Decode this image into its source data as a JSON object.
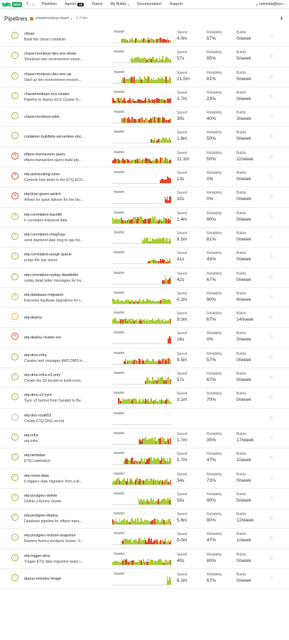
{
  "topbar": {
    "new_badge": "NEW",
    "org_short": "T...",
    "nav": [
      "Pipelines",
      "Agents",
      "Teams",
      "My Builds",
      "Documentation",
      "Support"
    ],
    "agents_count": "19",
    "user": "ralmeida@tyro..."
  },
  "header": {
    "title": "Pipelines",
    "org": "chaosmonkeys-team",
    "filter_placeholder": "Filter",
    "plus": "+"
  },
  "labels": {
    "speed": "Speed",
    "reliability": "Reliability",
    "builds": "Builds",
    "star": "☆"
  },
  "colors": {
    "pass": "#a9cc35",
    "fail": "#e0452f",
    "running": "#f2b32a"
  },
  "pipelines": [
    {
      "name": "cfman",
      "desc": "Build the cfman container",
      "status": "passed",
      "branch": "master",
      "speed": "4.0m",
      "reliability": "57%",
      "builds": "0/week",
      "chart": {
        "fill": 0.85,
        "height": 0.55,
        "fail": 0.35
      }
    },
    {
      "name": "chaos-monkeys-dev-env-down",
      "desc": "Shutdown dev environment resour...",
      "status": "passed",
      "branch": "master",
      "speed": "57s",
      "reliability": "95%",
      "builds": "5/week",
      "chart": {
        "fill": 0.7,
        "height": 0.7,
        "fail": 0.05
      }
    },
    {
      "name": "chaos-monkeys-dev-env-up",
      "desc": "Start up dev environment resourc...",
      "status": "passed",
      "branch": "master",
      "speed": "21.5m",
      "reliability": "81%",
      "builds": "5/week",
      "chart": {
        "fill": 0.85,
        "height": 0.75,
        "fail": 0.15
      }
    },
    {
      "name": "chaosmonkeys-ecs-cluster",
      "desc": "Pipeline to deploy ECS Cluster fo...",
      "status": "passed",
      "branch": "master",
      "speed": "3.7m",
      "reliability": "23%",
      "builds": "0/week",
      "chart": {
        "fill": 1.0,
        "height": 0.55,
        "fail": 0.7
      }
    },
    {
      "name": "chaos-monkeys-jobs",
      "desc": "",
      "status": "passed",
      "branch": "master",
      "speed": "30s",
      "reliability": "40%",
      "builds": "3/week",
      "chart": {
        "fill": 0.85,
        "height": 0.7,
        "fail": 0.45
      }
    },
    {
      "name": "container-buildkite-serverless-doc...",
      "desc": "",
      "status": "passed",
      "branch": "master",
      "speed": "1.6m",
      "reliability": "50%",
      "builds": "0/week",
      "chart": {
        "fill": 0.35,
        "height": 0.6,
        "fail": 0.4
      }
    },
    {
      "name": "eftpos-transaction-query",
      "desc": "eftpos-transaction-query build pip...",
      "status": "failed",
      "branch": "master",
      "speed": "11.1m",
      "reliability": "50%",
      "builds": "11/week",
      "chart": {
        "fill": 1.0,
        "height": 0.6,
        "fail": 0.45
      }
    },
    {
      "name": "etq-autoscaling-rules",
      "desc": "Controls how tasks in the ETQ ECS...",
      "status": "failed",
      "branch": "master",
      "speed": "13s",
      "reliability": "0%",
      "builds": "0/week",
      "chart": {
        "fill": 0.2,
        "height": 0.8,
        "fail": 1.0
      }
    },
    {
      "name": "etq-blue-green-switch",
      "desc": "Allows for quick failover for the blu...",
      "status": "failed",
      "branch": "master",
      "speed": "32s",
      "reliability": "0%",
      "builds": "0/week",
      "chart": {
        "fill": 0.12,
        "height": 0.8,
        "fail": 1.0
      }
    },
    {
      "name": "etq-correlation-backfill",
      "desc": "It correlates historical data",
      "status": "paused",
      "branch": "master",
      "speed": "2.4m",
      "reliability": "90%",
      "builds": "0/week",
      "chart": {
        "fill": 1.0,
        "height": 0.75,
        "fail": 0.3
      }
    },
    {
      "name": "etq-correlation-msg2sqs",
      "desc": "send start/end date msg to sqs for...",
      "status": "passed",
      "branch": "master",
      "speed": "8.5m",
      "reliability": "81%",
      "builds": "0/week",
      "chart": {
        "fill": 0.5,
        "height": 0.65,
        "fail": 0.2
      }
    },
    {
      "name": "etq-correlation-purge-queue",
      "desc": "purge the sqs queue",
      "status": "passed",
      "branch": "master",
      "speed": "41s",
      "reliability": "43%",
      "builds": "0/week",
      "chart": {
        "fill": 0.4,
        "height": 0.55,
        "fail": 0.45
      }
    },
    {
      "name": "etq-correlation-replay-deadletter",
      "desc": "replay dead letter messages for tra...",
      "status": "passed",
      "branch": "master",
      "speed": "42s",
      "reliability": "67%",
      "builds": "0/week",
      "chart": {
        "fill": 0.15,
        "height": 0.9,
        "fail": 0.4
      }
    },
    {
      "name": "etq-database-migration",
      "desc": "Executes liquibase migrations for t...",
      "status": "paused",
      "branch": "master",
      "speed": "6.2m",
      "reliability": "90%",
      "builds": "6/week",
      "chart": {
        "fill": 1.0,
        "height": 0.55,
        "fail": 0.15
      }
    },
    {
      "name": "etq-deploy",
      "desc": "",
      "status": "running",
      "branch": "master",
      "speed": "9.0m",
      "reliability": "67%",
      "builds": "14/week",
      "chart": {
        "fill": 1.0,
        "height": 0.6,
        "fail": 0.2
      }
    },
    {
      "name": "etq-deploy-cluster-svc",
      "desc": "",
      "status": "failed",
      "branch": "master",
      "speed": "16s",
      "reliability": "0%",
      "builds": "0/week",
      "chart": {
        "fill": 0.06,
        "height": 0.9,
        "fail": 1.0
      }
    },
    {
      "name": "etq-dms-infra",
      "desc": "Creates and manages AWS DMS in...",
      "status": "passed",
      "branch": "master",
      "speed": "9.5m",
      "reliability": "57%",
      "builds": "0/week",
      "chart": {
        "fill": 0.8,
        "height": 0.6,
        "fail": 0.45
      }
    },
    {
      "name": "etq-dms-infra-s3-only",
      "desc": "Create the S3 bucket in build envir...",
      "status": "passed",
      "branch": "master",
      "speed": "57s",
      "reliability": "67%",
      "builds": "0/week",
      "chart": {
        "fill": 0.45,
        "height": 0.8,
        "fail": 0.3
      }
    },
    {
      "name": "etq-dms-s3-sync",
      "desc": "Sync s3 bucket from Sandpit to Bu...",
      "status": "passed",
      "branch": "master",
      "speed": "3.1m",
      "reliability": "70%",
      "builds": "0/week",
      "chart": {
        "fill": 0.9,
        "height": 0.7,
        "fail": 0.2
      }
    },
    {
      "name": "etq-dns-route53",
      "desc": "Create ETQ DNS record",
      "status": "none",
      "branch": "master",
      "speed": "",
      "reliability": "",
      "builds": "",
      "chart": {
        "fill": 0.0,
        "height": 0.0,
        "fail": 0.0
      }
    },
    {
      "name": "etq-infra",
      "desc": "etq-infra",
      "status": "passed",
      "branch": "master",
      "speed": "1.7m",
      "reliability": "35%",
      "builds": "17/week",
      "chart": {
        "fill": 0.55,
        "height": 0.75,
        "fail": 0.5
      }
    },
    {
      "name": "etq-lambdas",
      "desc": "ETQ Lambda(s)",
      "status": "passed",
      "branch": "master",
      "speed": "5.7m",
      "reliability": "47%",
      "builds": "1/week",
      "chart": {
        "fill": 0.8,
        "height": 0.8,
        "fail": 0.35
      }
    },
    {
      "name": "etq-move-data",
      "desc": "It triggers data migration from a bl...",
      "status": "passed",
      "branch": "master",
      "speed": "34s",
      "reliability": "73%",
      "builds": "0/week",
      "chart": {
        "fill": 1.0,
        "height": 0.7,
        "fail": 0.25
      }
    },
    {
      "name": "etq-postgres-delete",
      "desc": "Delete a Aurora cluster",
      "status": "passed",
      "branch": "master",
      "speed": "50s",
      "reliability": "90%",
      "builds": "5/week",
      "chart": {
        "fill": 0.55,
        "height": 0.75,
        "fail": 0.15
      }
    },
    {
      "name": "etq-postgres-deploy",
      "desc": "Database pipeline for eftpos-trans...",
      "status": "passed",
      "branch": "master",
      "speed": "5.6m",
      "reliability": "90%",
      "builds": "12/week",
      "chart": {
        "fill": 1.0,
        "height": 0.7,
        "fail": 0.15
      }
    },
    {
      "name": "etq-postgres-restore-snapshot",
      "desc": "Restore Aurora postgres cluster. V...",
      "status": "passed",
      "branch": "master",
      "speed": "9.0m",
      "reliability": "47%",
      "builds": "1/week",
      "chart": {
        "fill": 0.85,
        "height": 0.75,
        "fail": 0.4
      }
    },
    {
      "name": "etq-trigger-dms",
      "desc": "Trigger ETQ data migration tasks i...",
      "status": "passed",
      "branch": "master",
      "speed": "40s",
      "reliability": "80%",
      "builds": "0/week",
      "chart": {
        "fill": 1.0,
        "height": 0.65,
        "fail": 0.25
      }
    },
    {
      "name": "taurus-molotov-image",
      "desc": "",
      "status": "passed",
      "branch": "master",
      "speed": "8.2m",
      "reliability": "67%",
      "builds": "0/week",
      "chart": {
        "fill": 0.08,
        "height": 0.9,
        "fail": 0.2
      }
    }
  ]
}
